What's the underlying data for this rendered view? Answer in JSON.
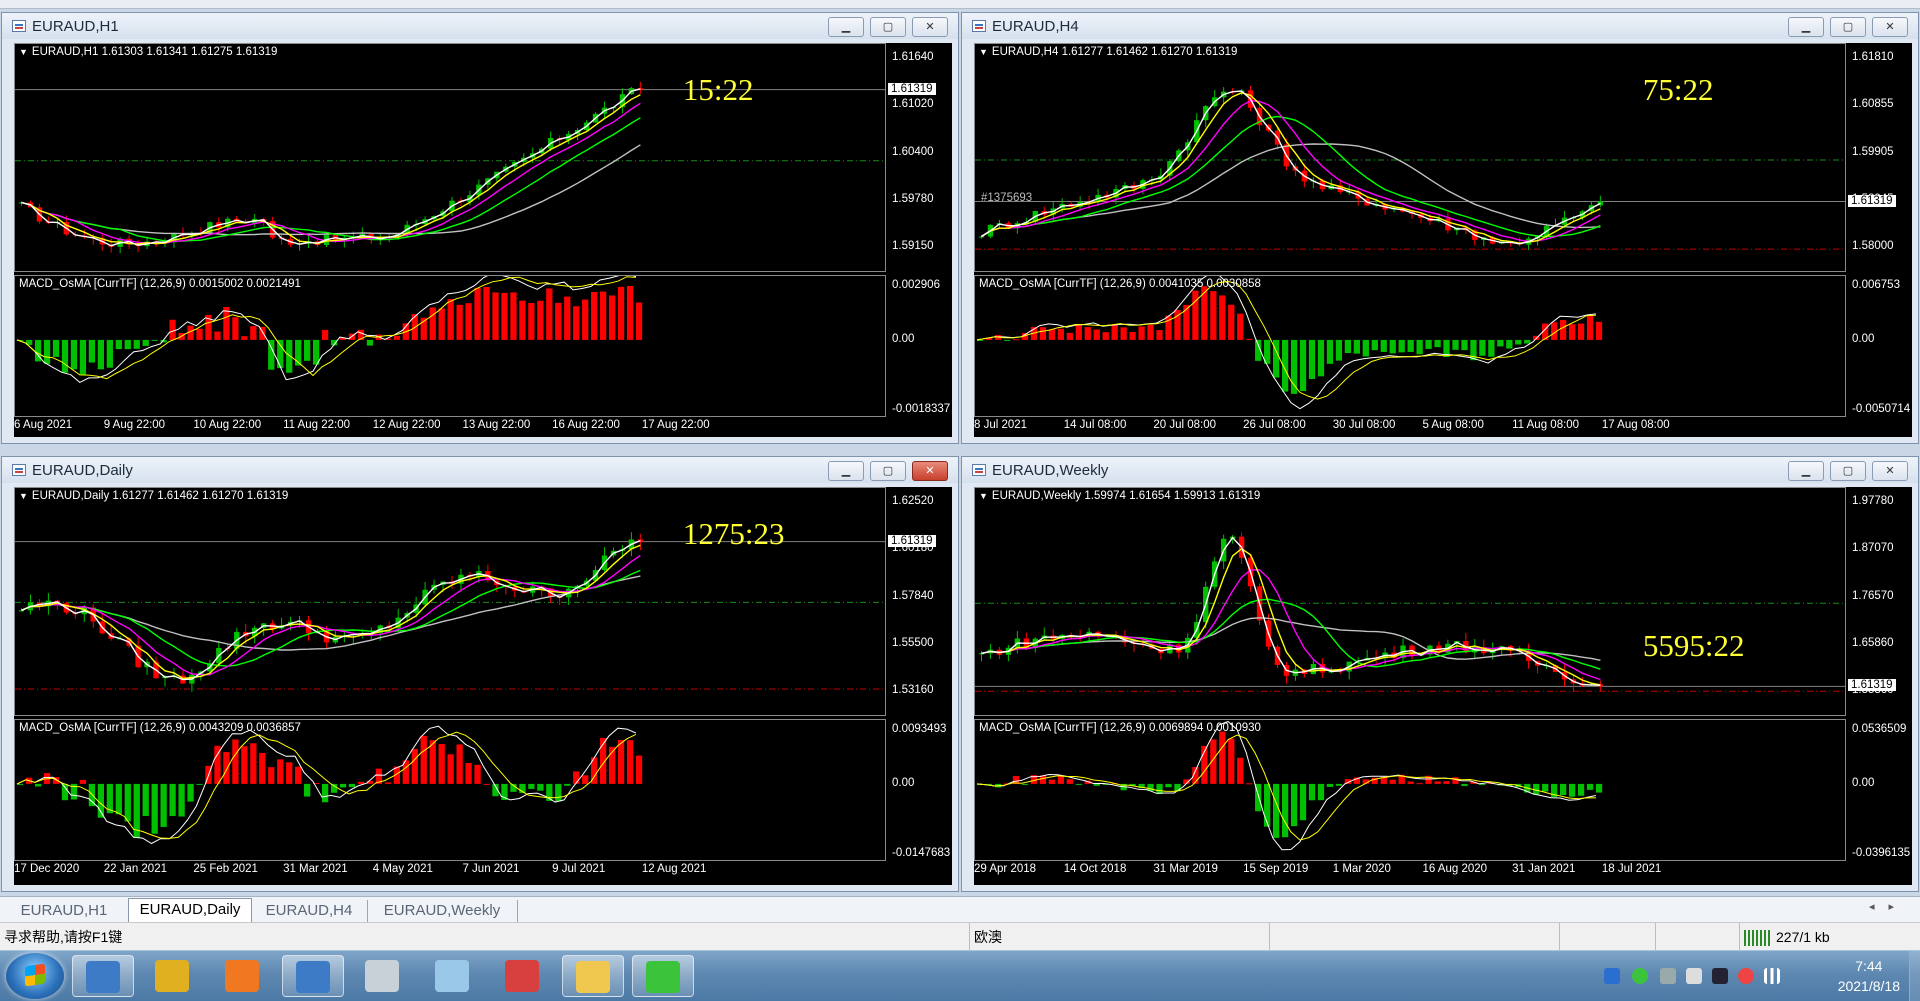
{
  "windows": [
    {
      "id": "h1",
      "title": "EURAUD,H1",
      "close_active": false,
      "header": "EURAUD,H1  1.61303 1.61341 1.61275 1.61319",
      "current_price_tag": "1.61319",
      "price_axis": [
        "1.61640",
        "1.61020",
        "1.60400",
        "1.59780",
        "1.59150"
      ],
      "countdown": "15:22",
      "macd_header": "MACD_OsMA [CurrTF] (12,26,9) 0.0015002 0.0021491",
      "macd_axis": [
        "0.002906",
        "0.00",
        "-0.0018337"
      ],
      "x_labels": [
        "6 Aug 2021",
        "9 Aug 22:00",
        "10 Aug 22:00",
        "11 Aug 22:00",
        "12 Aug 22:00",
        "13 Aug 22:00",
        "16 Aug 22:00",
        "17 Aug 22:00"
      ],
      "has_red_level": false
    },
    {
      "id": "h4",
      "title": "EURAUD,H4",
      "close_active": false,
      "header": "EURAUD,H4  1.61277 1.61462 1.61270 1.61319",
      "current_price_tag": "1.61319",
      "price_axis": [
        "1.61810",
        "1.60855",
        "1.59905",
        "1.58945",
        "1.58000"
      ],
      "countdown": "75:22",
      "macd_header": "MACD_OsMA [CurrTF] (12,26,9) 0.0041035 0.0030858",
      "macd_axis": [
        "0.006753",
        "0.00",
        "-0.0050714"
      ],
      "x_labels": [
        "8 Jul 2021",
        "14 Jul 08:00",
        "20 Jul 08:00",
        "26 Jul 08:00",
        "30 Jul 08:00",
        "5 Aug 08:00",
        "11 Aug 08:00",
        "17 Aug 08:00"
      ],
      "extra_label": "#1375693",
      "has_red_level": true
    },
    {
      "id": "daily",
      "title": "EURAUD,Daily",
      "close_active": true,
      "header": "EURAUD,Daily  1.61277 1.61462 1.61270 1.61319",
      "current_price_tag": "1.61319",
      "price_axis": [
        "1.62520",
        "1.60180",
        "1.57840",
        "1.55500",
        "1.53160"
      ],
      "countdown": "1275:23",
      "macd_header": "MACD_OsMA [CurrTF] (12,26,9) 0.0043209 0.0036857",
      "macd_axis": [
        "0.0093493",
        "0.00",
        "-0.0147683"
      ],
      "x_labels": [
        "17 Dec 2020",
        "22 Jan 2021",
        "25 Feb 2021",
        "31 Mar 2021",
        "4 May 2021",
        "7 Jun 2021",
        "9 Jul 2021",
        "12 Aug 2021"
      ],
      "has_red_level": true
    },
    {
      "id": "weekly",
      "title": "EURAUD,Weekly",
      "close_active": false,
      "header": "EURAUD,Weekly  1.59974 1.61654 1.59913 1.61319",
      "current_price_tag": "1.61319",
      "price_axis": [
        "1.97780",
        "1.87070",
        "1.76570",
        "1.65860",
        "1.55360"
      ],
      "countdown": "5595:22",
      "macd_header": "MACD_OsMA [CurrTF] (12,26,9) 0.0069894 0.0010930",
      "macd_axis": [
        "0.0536509",
        "0.00",
        "-0.0396135"
      ],
      "x_labels": [
        "29 Apr 2018",
        "14 Oct 2018",
        "31 Mar 2019",
        "15 Sep 2019",
        "1 Mar 2020",
        "16 Aug 2020",
        "31 Jan 2021",
        "18 Jul 2021"
      ],
      "has_red_level": true
    }
  ],
  "window_buttons": {
    "minimize": "▁",
    "maximize": "▢",
    "close": "✕"
  },
  "tabs": [
    "EURAUD,H1",
    "EURAUD,Daily",
    "EURAUD,H4",
    "EURAUD,Weekly"
  ],
  "active_tab": "EURAUD,Daily",
  "status": {
    "help": "寻求帮助,请按F1键",
    "profile": "欧澳",
    "traffic": "227/1 kb"
  },
  "taskbar": {
    "apps": [
      {
        "name": "metatrader-icon",
        "color": "#3d7bc7",
        "open": true
      },
      {
        "name": "dollar-app-icon",
        "color": "#e0b020",
        "open": false
      },
      {
        "name": "orange-sync-icon",
        "color": "#f07820",
        "open": false
      },
      {
        "name": "metatrader-icon",
        "color": "#3d7bc7",
        "open": true
      },
      {
        "name": "media-player-icon",
        "color": "#c8d0d8",
        "open": false
      },
      {
        "name": "notepad-icon",
        "color": "#9ac8e8",
        "open": false
      },
      {
        "name": "paint-icon",
        "color": "#d84040",
        "open": false
      },
      {
        "name": "folder-icon",
        "color": "#f0c850",
        "open": true
      },
      {
        "name": "wechat-icon",
        "color": "#3cc33c",
        "open": true
      }
    ],
    "time": "7:44",
    "date": "2021/8/18"
  },
  "colors": {
    "bull": "#00c000",
    "bear": "#ff0000",
    "ma_yellow": "#ffff00",
    "ma_magenta": "#ff00ff",
    "ma_green": "#00ff00",
    "ma_silver": "#c0c0c0",
    "countdown": "#ffff33"
  }
}
